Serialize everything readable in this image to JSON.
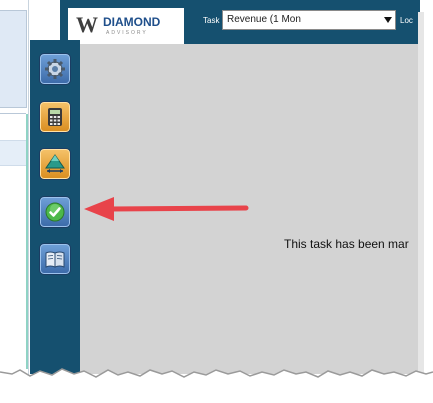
{
  "header": {
    "logo_text": "DIAMOND",
    "logo_subtext": "ADVISORY",
    "task_label": "Task",
    "task_value": "Revenue (1 Mon",
    "location_label": "Loc"
  },
  "sidebar": {
    "tools": [
      {
        "name": "settings",
        "icon": "gear-icon"
      },
      {
        "name": "calculator",
        "icon": "calculator-icon"
      },
      {
        "name": "pyramid",
        "icon": "pyramid-icon"
      },
      {
        "name": "complete",
        "icon": "check-circle-icon"
      },
      {
        "name": "book",
        "icon": "book-icon"
      }
    ]
  },
  "main": {
    "message": "This task has been mar"
  },
  "annotation": {
    "arrow_color": "#e8434a"
  },
  "colors": {
    "sidebar": "#15506f",
    "content_bg": "#d3d3d3"
  }
}
